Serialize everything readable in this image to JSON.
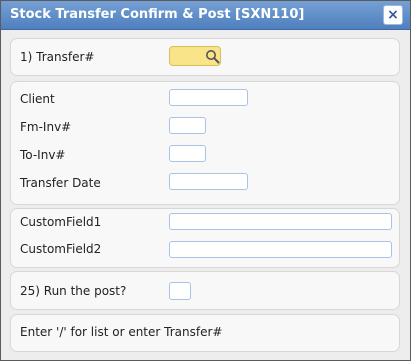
{
  "window": {
    "title": "Stock Transfer Confirm & Post [SXN110]",
    "close_glyph": "×"
  },
  "transfer": {
    "label": "1) Transfer#",
    "value": "",
    "lookup_icon": "search-icon"
  },
  "details": {
    "client_label": "Client",
    "client_value": "",
    "fm_inv_label": "Fm-Inv#",
    "fm_inv_value": "",
    "to_inv_label": "To-Inv#",
    "to_inv_value": "",
    "transfer_date_label": "Transfer Date",
    "transfer_date_value": ""
  },
  "custom": {
    "field1_label": "CustomField1",
    "field1_value": "",
    "field2_label": "CustomField2",
    "field2_value": ""
  },
  "run": {
    "label": "25) Run the post?",
    "value": ""
  },
  "status": {
    "message": "Enter '/' for list or enter Transfer#"
  },
  "colors": {
    "titlebar": "#4f7fbe",
    "lookup_field": "#fae48a",
    "input_border": "#a9c3e3"
  }
}
